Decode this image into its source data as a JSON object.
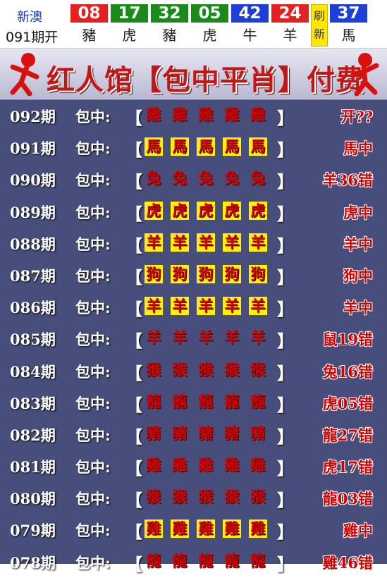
{
  "header": {
    "brand_line1": "新澳",
    "brand_line2": "091期开",
    "balls": [
      {
        "num": "08",
        "zodiac": "豬",
        "color": "#e52020"
      },
      {
        "num": "17",
        "zodiac": "虎",
        "color": "#1b8a1b"
      },
      {
        "num": "32",
        "zodiac": "豬",
        "color": "#1b8a1b"
      },
      {
        "num": "05",
        "zodiac": "虎",
        "color": "#1b8a1b"
      },
      {
        "num": "42",
        "zodiac": "牛",
        "color": "#1e3fd6"
      },
      {
        "num": "24",
        "zodiac": "羊",
        "color": "#e52020"
      },
      {
        "num": "37",
        "zodiac": "馬",
        "color": "#1e3fd6"
      }
    ],
    "refresh_top": "刷",
    "refresh_bottom": "新"
  },
  "banner": {
    "title": "红人馆【包中平肖】付费版"
  },
  "list": {
    "label": "包中:",
    "bracket_left": "【",
    "bracket_right": "】",
    "rows": [
      {
        "issue": "092期",
        "zodiac": "雞",
        "highlight": false,
        "result": "开??"
      },
      {
        "issue": "091期",
        "zodiac": "馬",
        "highlight": true,
        "result": "馬中"
      },
      {
        "issue": "090期",
        "zodiac": "兔",
        "highlight": false,
        "result": "羊36错"
      },
      {
        "issue": "089期",
        "zodiac": "虎",
        "highlight": true,
        "result": "虎中"
      },
      {
        "issue": "088期",
        "zodiac": "羊",
        "highlight": true,
        "result": "羊中"
      },
      {
        "issue": "087期",
        "zodiac": "狗",
        "highlight": true,
        "result": "狗中"
      },
      {
        "issue": "086期",
        "zodiac": "羊",
        "highlight": true,
        "result": "羊中"
      },
      {
        "issue": "085期",
        "zodiac": "羊",
        "highlight": false,
        "result": "鼠19错"
      },
      {
        "issue": "084期",
        "zodiac": "猴",
        "highlight": false,
        "result": "兔16错"
      },
      {
        "issue": "083期",
        "zodiac": "龍",
        "highlight": false,
        "result": "虎05错"
      },
      {
        "issue": "082期",
        "zodiac": "豬",
        "highlight": false,
        "result": "龍27错"
      },
      {
        "issue": "081期",
        "zodiac": "雞",
        "highlight": false,
        "result": "虎17错"
      },
      {
        "issue": "080期",
        "zodiac": "猴",
        "highlight": false,
        "result": "龍03错"
      },
      {
        "issue": "079期",
        "zodiac": "雞",
        "highlight": true,
        "result": "雞中"
      },
      {
        "issue": "078期",
        "zodiac": "龍",
        "highlight": false,
        "result": "雞46错"
      }
    ]
  }
}
